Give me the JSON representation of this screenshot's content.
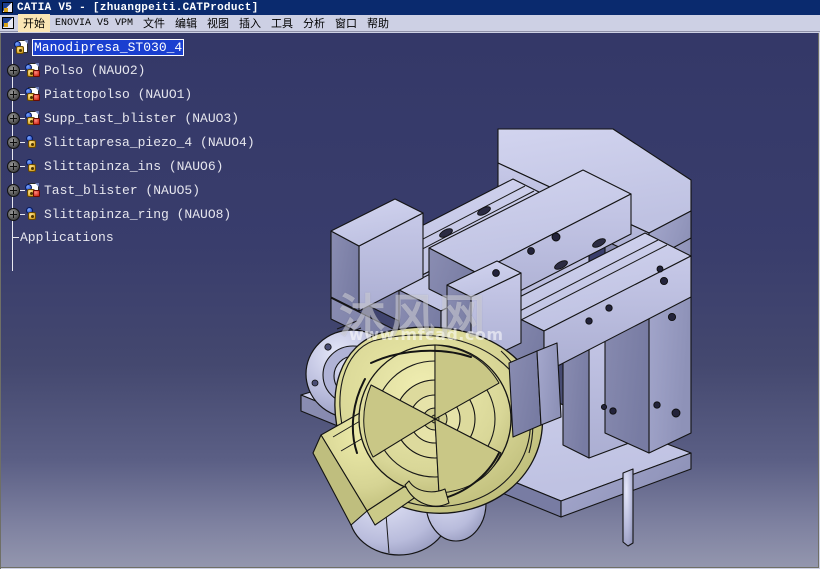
{
  "window": {
    "title": "CATIA V5 - [zhuangpeiti.CATProduct]",
    "app_icon": "catia-logo-icon"
  },
  "menubar": {
    "icon": "catia-logo-icon",
    "items": [
      {
        "label": "开始",
        "active": true,
        "mono": false
      },
      {
        "label": "ENOVIA V5 VPM",
        "active": false,
        "mono": true
      },
      {
        "label": "文件",
        "active": false,
        "mono": false
      },
      {
        "label": "编辑",
        "active": false,
        "mono": false
      },
      {
        "label": "视图",
        "active": false,
        "mono": false
      },
      {
        "label": "插入",
        "active": false,
        "mono": false
      },
      {
        "label": "工具",
        "active": false,
        "mono": false
      },
      {
        "label": "分析",
        "active": false,
        "mono": false
      },
      {
        "label": "窗口",
        "active": false,
        "mono": false
      },
      {
        "label": "帮助",
        "active": false,
        "mono": false
      }
    ]
  },
  "tree": {
    "root": {
      "label": "Manodipresa_ST030_4",
      "selected": true,
      "icon": "product-document-icon"
    },
    "children": [
      {
        "label": "Polso (NAUO2)",
        "icon": "part-document-icon",
        "expandable": true
      },
      {
        "label": "Piattopolso (NAUO1)",
        "icon": "part-document-icon",
        "expandable": true
      },
      {
        "label": "Supp_tast_blister (NAUO3)",
        "icon": "part-document-icon",
        "expandable": true
      },
      {
        "label": "Slittapresa_piezo_4 (NAUO4)",
        "icon": "product-gear-icon",
        "expandable": true
      },
      {
        "label": "Slittapinza_ins (NAUO6)",
        "icon": "product-gear-icon",
        "expandable": true
      },
      {
        "label": "Tast_blister (NAUO5)",
        "icon": "part-document-icon",
        "expandable": true
      },
      {
        "label": "Slittapinza_ring (NAUO8)",
        "icon": "product-gear-icon",
        "expandable": true
      }
    ],
    "applications": {
      "label": "Applications"
    }
  },
  "watermark": {
    "chinese": "沐风网",
    "url": "www.mfcad.com"
  },
  "colors": {
    "titlebar": "#0a2a6e",
    "menubar": "#cdd0e4",
    "menu_active": "#fbe6b4",
    "viewport_top": "#343868",
    "viewport_bottom": "#9396ae",
    "tree_text": "#e6e6ee",
    "selection": "#1a3fd0",
    "metal_light": "#c9cbe8",
    "metal_mid": "#aeb1d4",
    "metal_dark": "#8b8fb4",
    "metal_shadow": "#74789e",
    "yellow_part": "#d6d494",
    "yellow_dark": "#b9b873",
    "outline": "#141414"
  }
}
